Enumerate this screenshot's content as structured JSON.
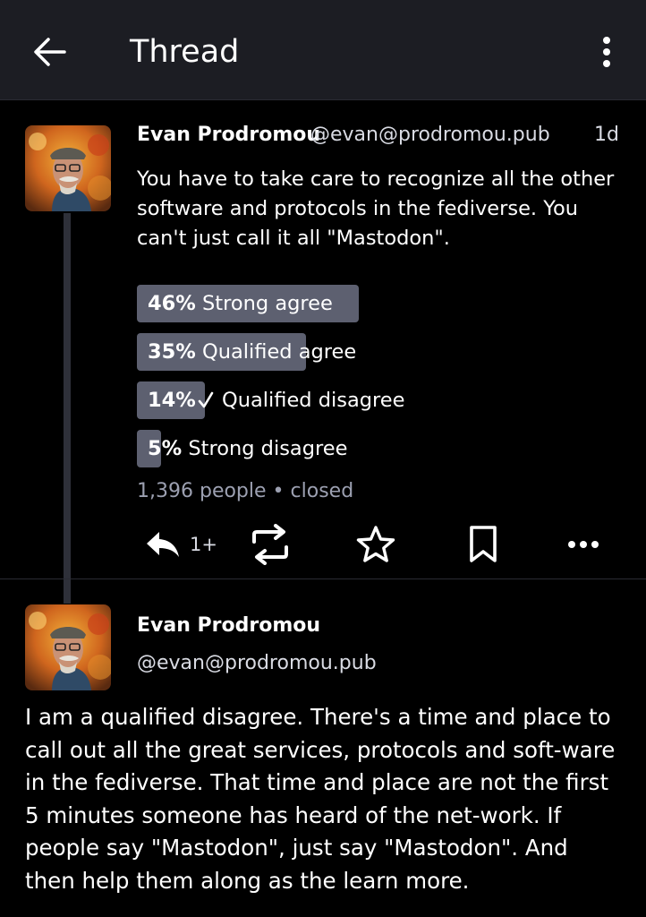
{
  "header": {
    "title": "Thread"
  },
  "post1": {
    "author_name": "Evan Prodromou",
    "author_handle": "@evan@prodromou.pub",
    "timestamp": "1d",
    "body": "You have to take care to recognize all the other software and protocols in the fediverse. You can't just call it all \"Mastodon\".",
    "poll": {
      "options": [
        {
          "percent_label": "46%",
          "percent": 46,
          "text": "Strong agree",
          "voted": false
        },
        {
          "percent_label": "35%",
          "percent": 35,
          "text": "Qualified agree",
          "voted": false
        },
        {
          "percent_label": "14%",
          "percent": 14,
          "text": "Qualified disagree",
          "voted": true
        },
        {
          "percent_label": "5%",
          "percent": 5,
          "text": "Strong disagree",
          "voted": false
        }
      ],
      "voters": "1,396 people",
      "separator": "•",
      "status": "closed"
    },
    "actions": {
      "reply_count": "1+"
    }
  },
  "post2": {
    "author_name": "Evan Prodromou",
    "author_handle": "@evan@prodromou.pub",
    "body": "I am a qualified disagree. There's a time and place to call out all the great services, protocols and soft-ware in the fediverse. That time and place are not the first 5 minutes someone has heard of the net-work. If people say \"Mastodon\", just say \"Mastodon\". And then help them along as the learn more."
  },
  "icons": {
    "back": "arrow-left-icon",
    "menu": "more-vertical-icon",
    "reply": "reply-icon",
    "boost": "boost-icon",
    "favourite": "star-icon",
    "bookmark": "bookmark-icon",
    "more": "more-horizontal-icon",
    "vote": "check-icon"
  },
  "colors": {
    "background": "#000000",
    "appbar": "#1c1d23",
    "poll_bar": "#5d6070",
    "secondary_text": "#9ca0b1",
    "thread_line": "#2e3039"
  }
}
